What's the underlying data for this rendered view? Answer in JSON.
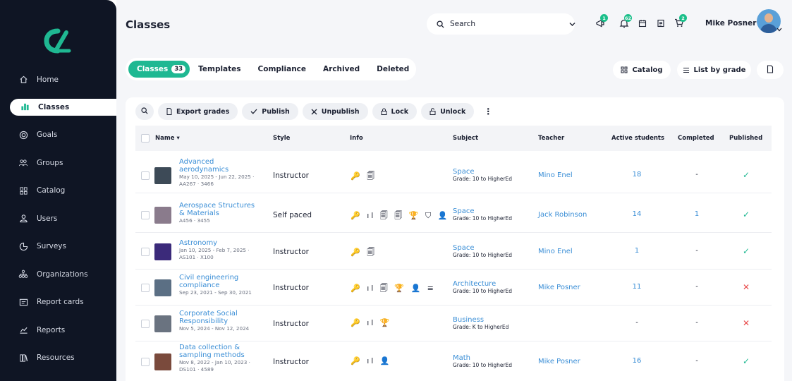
{
  "sidebar": {
    "items": [
      {
        "label": "Home",
        "icon": "home-icon"
      },
      {
        "label": "Classes",
        "icon": "classes-icon"
      },
      {
        "label": "Goals",
        "icon": "goals-icon"
      },
      {
        "label": "Groups",
        "icon": "groups-icon"
      },
      {
        "label": "Catalog",
        "icon": "catalog-icon"
      },
      {
        "label": "Users",
        "icon": "user-icon"
      },
      {
        "label": "Surveys",
        "icon": "survey-icon"
      },
      {
        "label": "Organizations",
        "icon": "organizations-icon"
      },
      {
        "label": "Report cards",
        "icon": "report-card-icon"
      },
      {
        "label": "Reports",
        "icon": "reports-icon"
      },
      {
        "label": "Resources",
        "icon": "resources-icon"
      }
    ]
  },
  "header": {
    "title": "Classes",
    "search_label": "Search",
    "notification_badges": [
      "1",
      "62",
      "2"
    ],
    "user_name": "Mike Posner"
  },
  "tabs": [
    {
      "label": "Classes",
      "count": "33"
    },
    {
      "label": "Templates"
    },
    {
      "label": "Compliance"
    },
    {
      "label": "Archived"
    },
    {
      "label": "Deleted"
    }
  ],
  "actions": {
    "catalog": "Catalog",
    "list_by_grade": "List by grade"
  },
  "toolbar": {
    "export_grades": "Export grades",
    "publish": "Publish",
    "unpublish": "Unpublish",
    "lock": "Lock",
    "unlock": "Unlock",
    "more": "⋮"
  },
  "table": {
    "headers": {
      "name": "Name",
      "style": "Style",
      "info": "Info",
      "subject": "Subject",
      "teacher": "Teacher",
      "active_students": "Active students",
      "completed": "Completed",
      "published": "Published"
    },
    "rows": [
      {
        "title": "Advanced aerodynamics",
        "dates": "May 10, 2025 - Jun 22, 2025 ·",
        "code": "AA267 · 3466",
        "style": "Instructor",
        "info": "🔑 🗐",
        "subject": "Space",
        "grade": "Grade: 10 to HigherEd",
        "teacher": "Mino Enel",
        "active": "18",
        "completed": "-",
        "published": "✓",
        "published_state": "yes",
        "thumb_color": "#3d4a57"
      },
      {
        "title": "Aerospace Structures & Materials",
        "dates": "",
        "code": "A456 · 3455",
        "style": "Self paced",
        "info": "🔑 ıl 🗐 🗐 🏆 ⛉ 👤",
        "subject": "Space",
        "grade": "Grade: 10 to HigherEd",
        "teacher": "Jack Robinson",
        "active": "14",
        "completed": "1",
        "published": "✓",
        "published_state": "yes",
        "thumb_color": "#8a7b8c"
      },
      {
        "title": "Astronomy",
        "dates": "Jan 10, 2025 - Feb 7, 2025 ·",
        "code": "AS101 · X100",
        "style": "Instructor",
        "info": "🔑 🗐",
        "subject": "Space",
        "grade": "Grade: 10 to HigherEd",
        "teacher": "Mino Enel",
        "active": "1",
        "completed": "-",
        "published": "✓",
        "published_state": "yes",
        "thumb_color": "#3b2a7a"
      },
      {
        "title": "Civil engineering compliance",
        "dates": "Sep 23, 2021 - Sep 30, 2021",
        "code": "",
        "style": "Instructor",
        "info": "🔑 ıl 🗐 🏆 👤 ≡",
        "subject": "Architecture",
        "grade": "Grade: 10 to HigherEd",
        "teacher": "Mike Posner",
        "active": "11",
        "completed": "-",
        "published": "✕",
        "published_state": "no",
        "thumb_color": "#5b6f84"
      },
      {
        "title": "Corporate Social Responsibility",
        "dates": "Nov 5, 2024 - Nov 12, 2024",
        "code": "",
        "style": "Instructor",
        "info": "🔑 ıl 🏆",
        "subject": "Business",
        "grade": "Grade: K to HigherEd",
        "teacher": "",
        "active": "-",
        "completed": "-",
        "published": "✕",
        "published_state": "no",
        "thumb_color": "#6a7380"
      },
      {
        "title": "Data collection & sampling methods",
        "dates": "Nov 8, 2022 - Jan 10, 2023 ·",
        "code": "DS101 · 4589",
        "style": "Instructor",
        "info": "🔑 ıl 👤",
        "subject": "Math",
        "grade": "Grade: 10 to HigherEd",
        "teacher": "Mike Posner",
        "active": "16",
        "completed": "-",
        "published": "✓",
        "published_state": "yes",
        "thumb_color": "#7a4a3c"
      }
    ]
  },
  "colors": {
    "accent": "#1fb892",
    "link": "#3a8ed6",
    "sidebar": "#0f1524",
    "danger": "#e84a4a"
  }
}
